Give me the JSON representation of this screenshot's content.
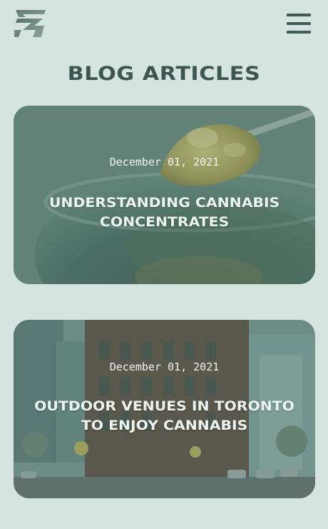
{
  "header": {
    "logo_icon": "brand-logo-icon",
    "menu_icon": "hamburger-menu-icon"
  },
  "page": {
    "title": "BLOG ARTICLES"
  },
  "articles": [
    {
      "date": "December 01, 2021",
      "title": "UNDERSTANDING CANNABIS CONCENTRATES",
      "image": "cannabis-concentrate-photo"
    },
    {
      "date": "December 01, 2021",
      "title": "OUTDOOR VENUES IN TORONTO TO ENJOY CANNABIS",
      "image": "toronto-street-photo"
    }
  ],
  "colors": {
    "background": "#d6e4e0",
    "heading": "#3d5651",
    "accent": "#3f5b55"
  }
}
